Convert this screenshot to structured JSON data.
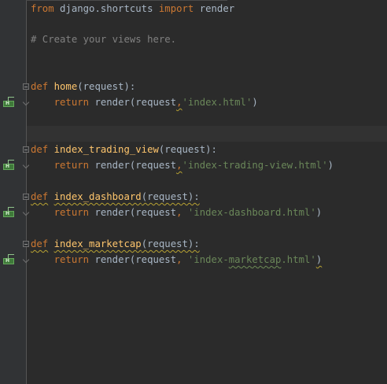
{
  "editor": {
    "lines": [
      {
        "tokens": [
          {
            "text": "from",
            "kind": "kw"
          },
          {
            "text": " django.shortcuts ",
            "kind": "plain"
          },
          {
            "text": "import",
            "kind": "kw"
          },
          {
            "text": " render",
            "kind": "plain"
          }
        ]
      },
      {
        "tokens": [
          {
            "text": "# Create your views here.",
            "kind": "cmt"
          }
        ]
      },
      {
        "tokens": [
          {
            "text": "def",
            "kind": "kw"
          },
          {
            "text": " ",
            "kind": "plain"
          },
          {
            "text": "home",
            "kind": "fn"
          },
          {
            "text": "(request):",
            "kind": "plain"
          }
        ]
      },
      {
        "tokens": [
          {
            "text": "    ",
            "kind": "plain"
          },
          {
            "text": "return",
            "kind": "kw"
          },
          {
            "text": " render(request",
            "kind": "plain"
          },
          {
            "text": ",",
            "kind": "kw_squig"
          },
          {
            "text": "'index.html'",
            "kind": "str"
          },
          {
            "text": ")",
            "kind": "plain"
          }
        ]
      },
      {
        "tokens": [
          {
            "text": "def",
            "kind": "kw"
          },
          {
            "text": " ",
            "kind": "plain"
          },
          {
            "text": "index_trading_view",
            "kind": "fn"
          },
          {
            "text": "(request):",
            "kind": "plain"
          }
        ]
      },
      {
        "tokens": [
          {
            "text": "    ",
            "kind": "plain"
          },
          {
            "text": "return",
            "kind": "kw"
          },
          {
            "text": " render(request",
            "kind": "plain"
          },
          {
            "text": ",",
            "kind": "kw_squig"
          },
          {
            "text": "'index-trading-view.html'",
            "kind": "str"
          },
          {
            "text": ")",
            "kind": "plain"
          }
        ]
      },
      {
        "tokens": [
          {
            "text": "def",
            "kind": "kw_squig"
          },
          {
            "text": " ",
            "kind": "plain"
          },
          {
            "text": "index_dashboard",
            "kind": "fn_squig"
          },
          {
            "text": "(request):",
            "kind": "plain_squig"
          }
        ]
      },
      {
        "tokens": [
          {
            "text": "    ",
            "kind": "plain"
          },
          {
            "text": "return",
            "kind": "kw"
          },
          {
            "text": " render(request",
            "kind": "plain"
          },
          {
            "text": ",",
            "kind": "kw"
          },
          {
            "text": " ",
            "kind": "plain"
          },
          {
            "text": "'index-dashboard.html'",
            "kind": "str"
          },
          {
            "text": ")",
            "kind": "plain"
          }
        ]
      },
      {
        "tokens": [
          {
            "text": "def",
            "kind": "kw_squig"
          },
          {
            "text": " ",
            "kind": "plain"
          },
          {
            "text": "index_marketcap",
            "kind": "fn_squig"
          },
          {
            "text": "(request):",
            "kind": "plain_squig"
          }
        ]
      },
      {
        "tokens": [
          {
            "text": "    ",
            "kind": "plain"
          },
          {
            "text": "return",
            "kind": "kw"
          },
          {
            "text": " render(request",
            "kind": "plain"
          },
          {
            "text": ",",
            "kind": "kw"
          },
          {
            "text": " ",
            "kind": "plain"
          },
          {
            "text": "'index-",
            "kind": "str"
          },
          {
            "text": "marketcap",
            "kind": "str_squig"
          },
          {
            "text": ".html'",
            "kind": "str"
          },
          {
            "text": ")",
            "kind": "plain_squig"
          }
        ]
      }
    ],
    "colors": {
      "background": "#2b2b2b",
      "gutter": "#313335",
      "current_line": "#323232",
      "keyword": "#cc7832",
      "function": "#ffc66d",
      "string": "#6a8759",
      "comment": "#808080",
      "text": "#a9b7c6"
    },
    "gutter_icons": [
      "override-method-icon",
      "override-method-icon",
      "override-method-icon",
      "override-method-icon"
    ],
    "fold_markers": [
      "fold-start-icon",
      "fold-end-icon"
    ]
  }
}
